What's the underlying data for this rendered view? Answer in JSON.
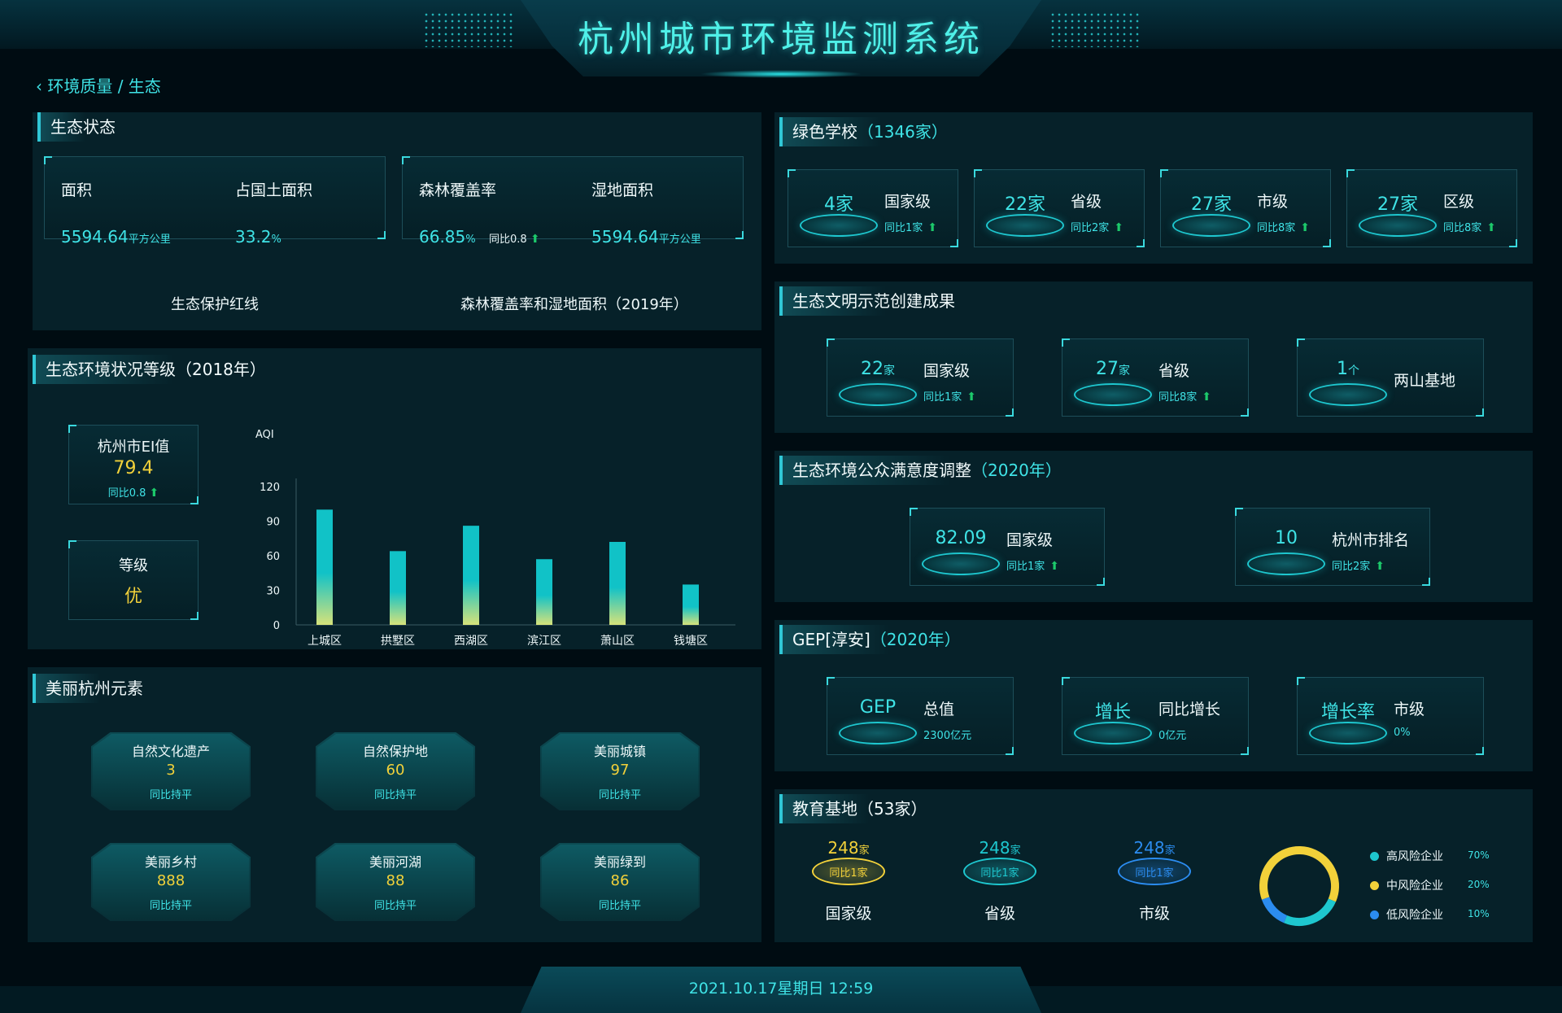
{
  "header": {
    "title": "杭州城市环境监测系统"
  },
  "breadcrumb": "‹ 环境质量 / 生态",
  "eco_status": {
    "title": "生态状态",
    "box1": {
      "area_label": "面积",
      "area_value": "5594.64",
      "area_unit": "平方公里",
      "share_label": "占国土面积",
      "share_value": "33.2",
      "share_unit": "%",
      "caption": "生态保护红线"
    },
    "box2": {
      "forest_label": "森林覆盖率",
      "forest_value": "66.85",
      "forest_unit": "%",
      "forest_yoy": "同比0.8",
      "wetland_label": "湿地面积",
      "wetland_value": "5594.64",
      "wetland_unit": "平方公里",
      "caption": "森林覆盖率和湿地面积（2019年）"
    }
  },
  "eco_grade": {
    "title": "生态环境状况等级（2018年）",
    "ei_label": "杭州市EI值",
    "ei_value": "79.4",
    "ei_yoy": "同比0.8",
    "grade_label": "等级",
    "grade_value": "优"
  },
  "chart_data": {
    "type": "bar",
    "ylabel": "AQI",
    "ylim": [
      0,
      120
    ],
    "yticks": [
      0,
      30,
      60,
      90,
      120
    ],
    "categories": [
      "上城区",
      "拱墅区",
      "西湖区",
      "滨江区",
      "萧山区",
      "钱塘区"
    ],
    "values": [
      100,
      64,
      86,
      57,
      72,
      35
    ],
    "colors": {
      "top": "#11c2c7",
      "bottom": "#d6e27a"
    }
  },
  "beauty": {
    "title": "美丽杭州元素",
    "items": [
      {
        "name": "自然文化遗产",
        "value": "3",
        "note": "同比持平"
      },
      {
        "name": "自然保护地",
        "value": "60",
        "note": "同比持平"
      },
      {
        "name": "美丽城镇",
        "value": "97",
        "note": "同比持平"
      },
      {
        "name": "美丽乡村",
        "value": "888",
        "note": "同比持平"
      },
      {
        "name": "美丽河湖",
        "value": "88",
        "note": "同比持平"
      },
      {
        "name": "美丽绿到",
        "value": "86",
        "note": "同比持平"
      }
    ]
  },
  "green_school": {
    "title": "绿色学校",
    "count": "（1346家）",
    "items": [
      {
        "num": "4家",
        "level": "国家级",
        "yoy": "同比1家"
      },
      {
        "num": "22家",
        "level": "省级",
        "yoy": "同比2家"
      },
      {
        "num": "27家",
        "level": "市级",
        "yoy": "同比8家"
      },
      {
        "num": "27家",
        "level": "区级",
        "yoy": "同比8家"
      }
    ]
  },
  "civilization": {
    "title": "生态文明示范创建成果",
    "items": [
      {
        "num": "22",
        "unit": "家",
        "level": "国家级",
        "yoy": "同比1家"
      },
      {
        "num": "27",
        "unit": "家",
        "level": "省级",
        "yoy": "同比8家"
      },
      {
        "num": "1",
        "unit": "个",
        "level": "两山基地",
        "yoy": ""
      }
    ]
  },
  "satisfaction": {
    "title": "生态环境公众满意度调整",
    "year": "（2020年）",
    "items": [
      {
        "num": "82.09",
        "level": "国家级",
        "yoy": "同比1家"
      },
      {
        "num": "10",
        "level": "杭州市排名",
        "yoy": "同比2家"
      }
    ]
  },
  "gep": {
    "title": "GEP[淳安]",
    "year": "（2020年）",
    "items": [
      {
        "num": "GEP",
        "level": "总值",
        "note": "2300亿元"
      },
      {
        "num": "增长",
        "level": "同比增长",
        "note": "0亿元"
      },
      {
        "num": "增长率",
        "level": "市级",
        "note": "0%"
      }
    ]
  },
  "education": {
    "title": "教育基地（53家）",
    "items": [
      {
        "num": "248",
        "unit": "家",
        "yoy": "同比1家",
        "level": "国家级",
        "color": "#f2d13a"
      },
      {
        "num": "248",
        "unit": "家",
        "yoy": "同比1家",
        "level": "省级",
        "color": "#1ec7cf"
      },
      {
        "num": "248",
        "unit": "家",
        "yoy": "同比1家",
        "level": "市级",
        "color": "#2b8cf0"
      }
    ],
    "legend": [
      {
        "name": "高风险企业",
        "pct": "70%",
        "value": 70,
        "color": "#1ec7cf"
      },
      {
        "name": "中风险企业",
        "pct": "20%",
        "value": 20,
        "color": "#f2d13a"
      },
      {
        "name": "低风险企业",
        "pct": "10%",
        "value": 10,
        "color": "#2b8cf0"
      }
    ]
  },
  "footer": {
    "datetime": "2021.10.17星期日 12:59"
  }
}
